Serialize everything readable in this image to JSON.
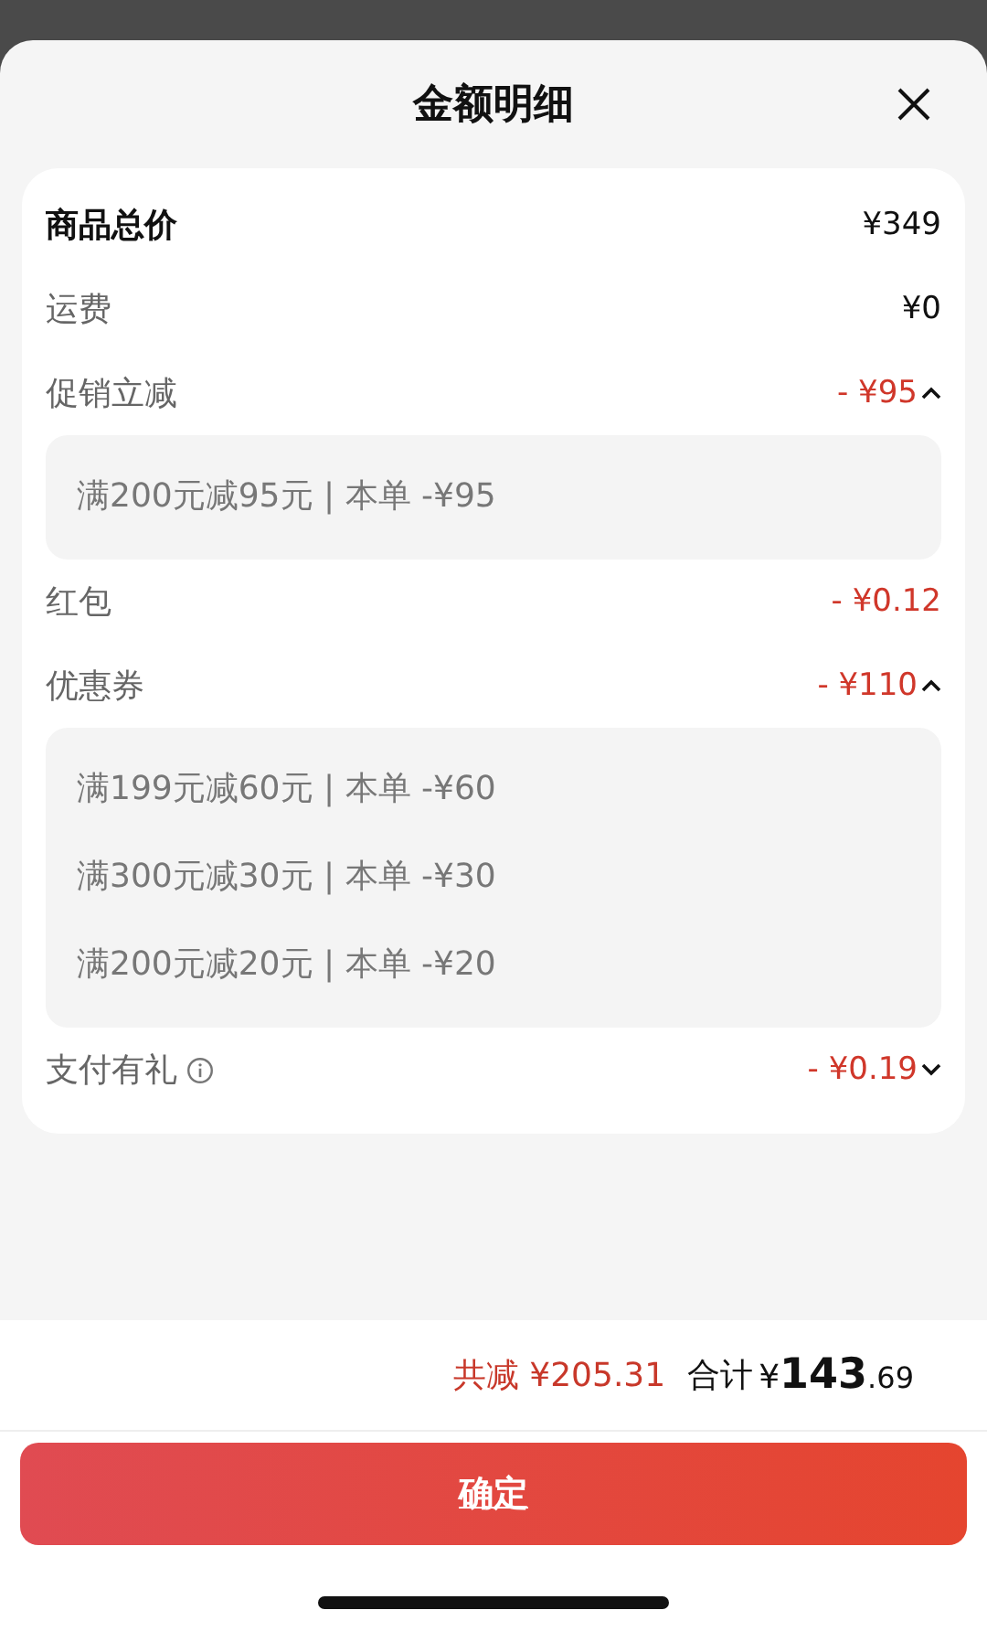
{
  "sheet": {
    "title": "金额明细"
  },
  "rows": [
    {
      "kind": "total",
      "label": "商品总价",
      "amount": "¥349"
    },
    {
      "kind": "plain",
      "label": "运费",
      "amount": "¥0"
    },
    {
      "kind": "discount",
      "label": "促销立减",
      "amount": "- ¥95",
      "expanded": true,
      "details": [
        "满200元减95元 | 本单 -¥95"
      ]
    },
    {
      "kind": "discount",
      "label": "红包",
      "amount": "- ¥0.12"
    },
    {
      "kind": "discount",
      "label": "优惠券",
      "amount": "- ¥110",
      "expanded": true,
      "details": [
        "满199元减60元 | 本单 -¥60",
        "满300元减30元 | 本单 -¥30",
        "满200元减20元 | 本单 -¥20"
      ]
    },
    {
      "kind": "discount",
      "label": "支付有礼",
      "amount": "- ¥0.19",
      "info": true,
      "expanded": false
    }
  ],
  "summary": {
    "saved": "共减 ¥205.31",
    "total_label": "合计",
    "currency": "¥",
    "integer": "143",
    "decimal": ".69"
  },
  "confirm_button": "确定"
}
